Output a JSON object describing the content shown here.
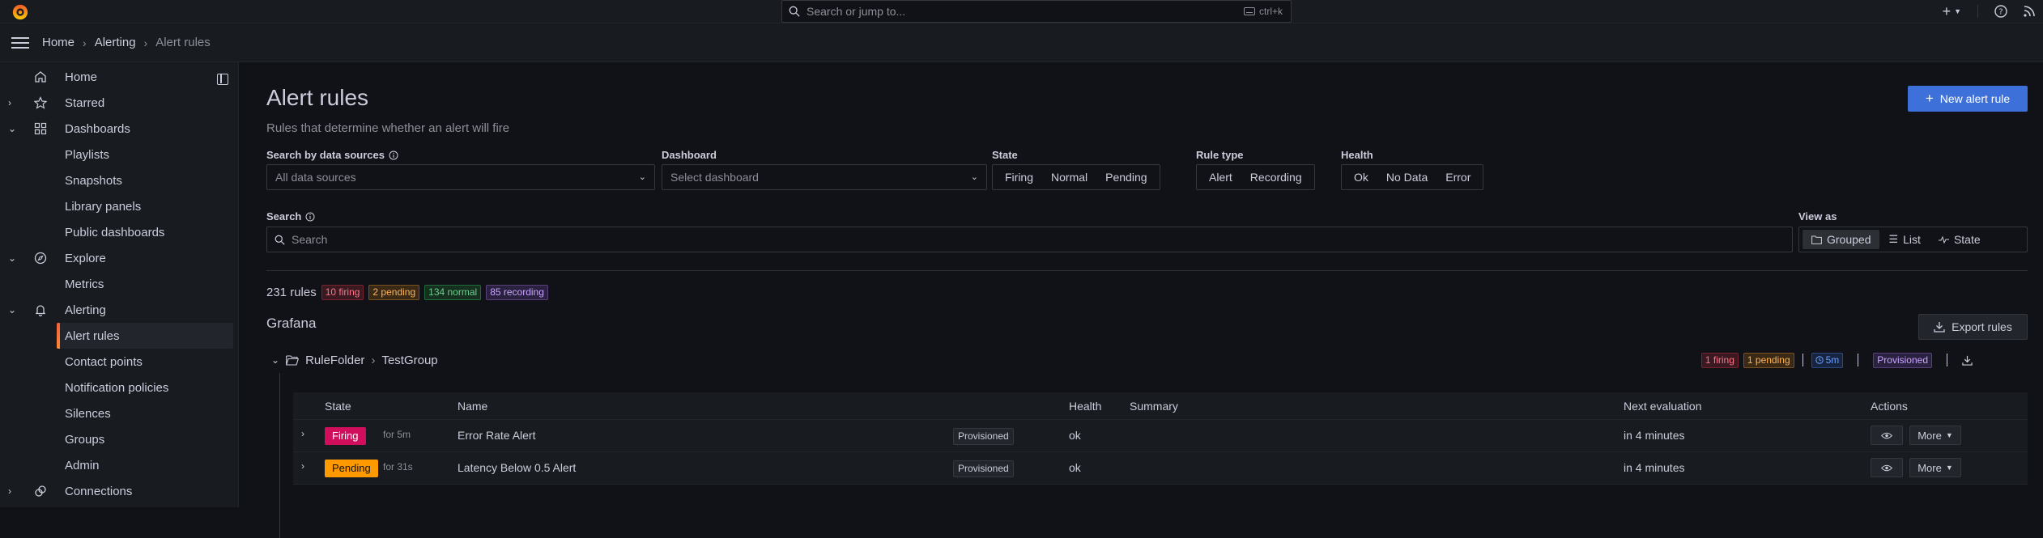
{
  "topbar": {
    "search_placeholder": "Search or jump to...",
    "shortcut": "ctrl+k"
  },
  "breadcrumb": {
    "items": [
      "Home",
      "Alerting",
      "Alert rules"
    ]
  },
  "sidebar": {
    "items": [
      {
        "label": "Home",
        "icon": "home-icon"
      },
      {
        "label": "Starred",
        "icon": "star-icon"
      },
      {
        "label": "Dashboards",
        "icon": "apps-icon"
      },
      {
        "label": "Playlists"
      },
      {
        "label": "Snapshots"
      },
      {
        "label": "Library panels"
      },
      {
        "label": "Public dashboards"
      },
      {
        "label": "Explore",
        "icon": "compass-icon"
      },
      {
        "label": "Metrics"
      },
      {
        "label": "Alerting",
        "icon": "bell-icon"
      },
      {
        "label": "Alert rules"
      },
      {
        "label": "Contact points"
      },
      {
        "label": "Notification policies"
      },
      {
        "label": "Silences"
      },
      {
        "label": "Groups"
      },
      {
        "label": "Admin"
      },
      {
        "label": "Connections",
        "icon": "connections-icon"
      }
    ]
  },
  "page": {
    "title": "Alert rules",
    "subtitle": "Rules that determine whether an alert will fire",
    "new_rule_button": "New alert rule"
  },
  "filters": {
    "datasource_label": "Search by data sources",
    "datasource_value": "All data sources",
    "dashboard_label": "Dashboard",
    "dashboard_value": "Select dashboard",
    "state_label": "State",
    "state_options": [
      "Firing",
      "Normal",
      "Pending"
    ],
    "ruletype_label": "Rule type",
    "ruletype_options": [
      "Alert",
      "Recording"
    ],
    "health_label": "Health",
    "health_options": [
      "Ok",
      "No Data",
      "Error"
    ],
    "search_label": "Search",
    "search_placeholder": "Search",
    "viewas_label": "View as",
    "viewas_options": [
      "Grouped",
      "List",
      "State"
    ]
  },
  "summary": {
    "total": "231 rules",
    "firing": "10 firing",
    "pending": "2 pending",
    "normal": "134 normal",
    "recording": "85 recording"
  },
  "section": {
    "title": "Grafana",
    "export_button": "Export rules"
  },
  "group": {
    "folder": "RuleFolder",
    "name": "TestGroup",
    "firing": "1 firing",
    "pending": "1 pending",
    "interval": "5m",
    "provisioned": "Provisioned"
  },
  "table": {
    "headers": [
      "State",
      "Name",
      "Health",
      "Summary",
      "Next evaluation",
      "Actions"
    ],
    "rows": [
      {
        "state": "Firing",
        "duration": "for 5m",
        "name": "Error Rate Alert",
        "provisioned": "Provisioned",
        "health": "ok",
        "next": "in 4 minutes",
        "more": "More"
      },
      {
        "state": "Pending",
        "duration": "for 31s",
        "name": "Latency Below 0.5 Alert",
        "provisioned": "Provisioned",
        "health": "ok",
        "next": "in 4 minutes",
        "more": "More"
      }
    ]
  },
  "colors": {
    "accent": "#3d71d9",
    "firing": "#d10e5c",
    "pending": "#ff9900"
  }
}
